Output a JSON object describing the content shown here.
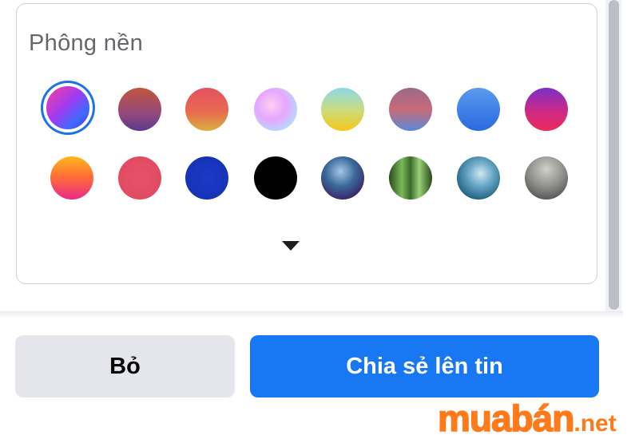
{
  "background_picker": {
    "title": "Phông nền",
    "swatches": [
      {
        "id": "swatch-1",
        "style": "linear-gradient(135deg,#ff3d9a 0%,#a13bf2 45%,#3b6bff 75%,#5b2bd8 100%)",
        "selected": true
      },
      {
        "id": "swatch-2",
        "style": "linear-gradient(180deg,#c0563a 0%,#9a4a7a 55%,#5a3a8a 100%)",
        "selected": false
      },
      {
        "id": "swatch-3",
        "style": "linear-gradient(180deg,#e6505e 0%,#e86a50 55%,#d8b040 100%)",
        "selected": false
      },
      {
        "id": "swatch-4",
        "style": "radial-gradient(circle at 40% 40%,#ffd0f0 0%,#e6a6ff 40%,#b8d8ff 75%,#ffffff 100%)",
        "selected": false
      },
      {
        "id": "swatch-5",
        "style": "linear-gradient(180deg,#8cd8e8 0%,#c8dc80 50%,#f6c818 100%)",
        "selected": false
      },
      {
        "id": "swatch-6",
        "style": "linear-gradient(180deg,#9a6a8a 0%,#c86a78 50%,#5a8ad8 100%)",
        "selected": false
      },
      {
        "id": "swatch-7",
        "style": "linear-gradient(180deg,#5a9aee 0%,#2a6ae0 100%)",
        "selected": false
      },
      {
        "id": "swatch-8",
        "style": "linear-gradient(180deg,#7a30c8 0%,#c82a8a 50%,#ee2a5a 100%)",
        "selected": false
      },
      {
        "id": "swatch-9",
        "style": "linear-gradient(180deg,#ffb618 0%,#ff6a3a 50%,#e62a8a 100%)",
        "selected": false
      },
      {
        "id": "swatch-10",
        "style": "radial-gradient(circle,#e6536a 0%,#e0485e 100%)",
        "selected": false
      },
      {
        "id": "swatch-11",
        "style": "radial-gradient(circle,#1a3ac8 0%,#1530b0 100%)",
        "selected": false
      },
      {
        "id": "swatch-12",
        "style": "radial-gradient(circle,#000000 0%,#000000 100%)",
        "selected": false
      },
      {
        "id": "swatch-13",
        "style": "radial-gradient(circle at 45% 35%,#a8c8e8 0%,#3a6a9a 40%,#3a2a6a 75%,#1a1a3a 100%)",
        "selected": false
      },
      {
        "id": "swatch-14",
        "style": "linear-gradient(90deg,#2a4a1a 0%,#7ab85a 30%,#3a6a2a 50%,#9ad07a 70%,#2a4a1a 100%)",
        "selected": false
      },
      {
        "id": "swatch-15",
        "style": "radial-gradient(circle at 55% 40%,#d0e8f0 0%,#6aa8c8 35%,#2a6a8a 70%,#0a3a5a 100%)",
        "selected": false
      },
      {
        "id": "swatch-16",
        "style": "radial-gradient(circle at 50% 30%,#d0d0c8 0%,#8a8a88 50%,#3a3a3a 100%)",
        "selected": false
      }
    ]
  },
  "actions": {
    "cancel_label": "Bỏ",
    "share_label": "Chia sẻ lên tin"
  },
  "watermark": {
    "main": "muabán",
    "suffix": ".net"
  },
  "colors": {
    "primary": "#1877f2",
    "secondary_bg": "#e4e6eb",
    "selected_ring": "#1b74e4",
    "watermark": "#ff7a1a"
  }
}
